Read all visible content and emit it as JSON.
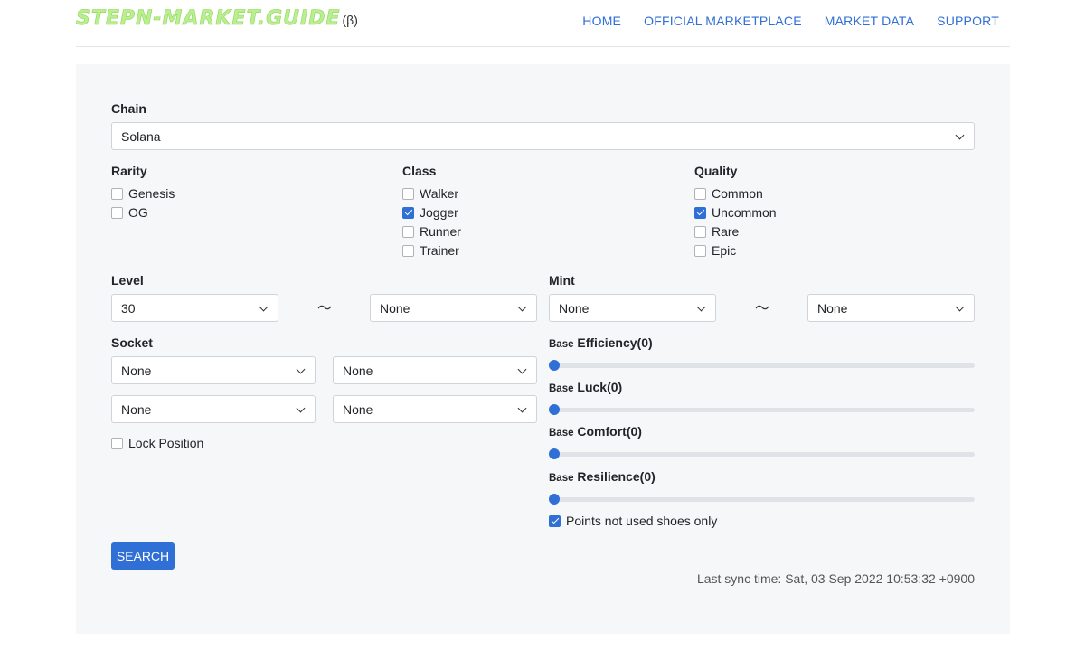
{
  "brand": {
    "logo": "STEPN-MARKET.GUIDE",
    "beta": "(β)"
  },
  "nav": [
    "HOME",
    "OFFICIAL MARKETPLACE",
    "MARKET DATA",
    "SUPPORT"
  ],
  "chain": {
    "label": "Chain",
    "value": "Solana"
  },
  "rarity": {
    "label": "Rarity",
    "options": [
      {
        "label": "Genesis",
        "checked": false
      },
      {
        "label": "OG",
        "checked": false
      }
    ]
  },
  "class": {
    "label": "Class",
    "options": [
      {
        "label": "Walker",
        "checked": false
      },
      {
        "label": "Jogger",
        "checked": true
      },
      {
        "label": "Runner",
        "checked": false
      },
      {
        "label": "Trainer",
        "checked": false
      }
    ]
  },
  "quality": {
    "label": "Quality",
    "options": [
      {
        "label": "Common",
        "checked": false
      },
      {
        "label": "Uncommon",
        "checked": true
      },
      {
        "label": "Rare",
        "checked": false
      },
      {
        "label": "Epic",
        "checked": false
      }
    ]
  },
  "level": {
    "label": "Level",
    "from": "30",
    "to": "None",
    "separator": "〜"
  },
  "mint": {
    "label": "Mint",
    "from": "None",
    "to": "None",
    "separator": "〜"
  },
  "socket": {
    "label": "Socket",
    "values": [
      "None",
      "None",
      "None",
      "None"
    ]
  },
  "lock_position": {
    "label": "Lock Position",
    "checked": false
  },
  "sliders": [
    {
      "prefix": "Base",
      "name": "Efficiency(0)",
      "value": 0
    },
    {
      "prefix": "Base",
      "name": "Luck(0)",
      "value": 0
    },
    {
      "prefix": "Base",
      "name": "Comfort(0)",
      "value": 0
    },
    {
      "prefix": "Base",
      "name": "Resilience(0)",
      "value": 0
    }
  ],
  "points_not_used": {
    "label": "Points not used shoes only",
    "checked": true
  },
  "search_button": "SEARCH",
  "sync": "Last sync time: Sat, 03 Sep 2022 10:53:32 +0900"
}
